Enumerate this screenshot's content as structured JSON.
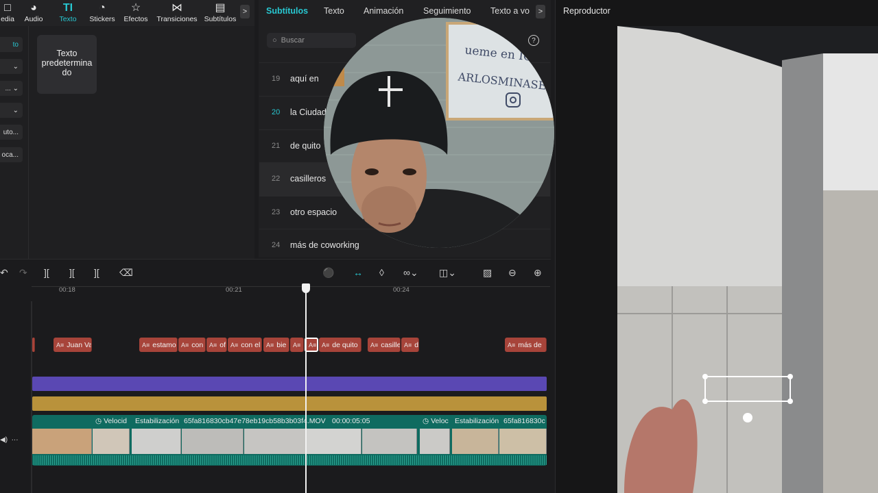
{
  "toolbar": {
    "items": [
      {
        "label": "edia",
        "icon": "media-icon"
      },
      {
        "label": "Audio",
        "icon": "audio-icon"
      },
      {
        "label": "Texto",
        "icon": "text-icon",
        "active": true
      },
      {
        "label": "Stickers",
        "icon": "sticker-icon"
      },
      {
        "label": "Efectos",
        "icon": "effects-icon"
      },
      {
        "label": "Transiciones",
        "icon": "transition-icon"
      },
      {
        "label": "Subtítulos",
        "icon": "subtitles-icon"
      }
    ],
    "more": ">"
  },
  "left_panel": {
    "items": [
      "to",
      "",
      "...",
      "",
      "uto...",
      "oca..."
    ],
    "preset_label": "Texto predetermina do"
  },
  "subtitles": {
    "tabs": [
      "Subtítulos",
      "Texto",
      "Animación",
      "Seguimiento",
      "Texto a vo"
    ],
    "more": ">",
    "search_placeholder": "Buscar",
    "help": "?",
    "rows": [
      {
        "num": "19",
        "text": "aquí en"
      },
      {
        "num": "20",
        "text": "la Ciudad"
      },
      {
        "num": "21",
        "text": "de quito"
      },
      {
        "num": "22",
        "text": "casilleros"
      },
      {
        "num": "23",
        "text": "otro espacio"
      },
      {
        "num": "24",
        "text": "más de coworking"
      }
    ]
  },
  "player": {
    "title": "Reproductor"
  },
  "timeline": {
    "ruler": [
      "00:18",
      "00:21",
      "00:24"
    ],
    "captions": [
      "Juan Va",
      "estamo",
      "con",
      "of",
      "con el",
      "bie",
      "",
      "",
      "de quito",
      "casille",
      "d",
      "más de"
    ],
    "video_labels": {
      "speed": "Velocid",
      "stab": "Estabilización",
      "file": "65fa816830cb47e78eb19cb58b3b03f4.MOV",
      "duration": "00:00:05:05",
      "speed2": "Veloc",
      "stab2": "Estabilización",
      "file2": "65fa816830c"
    },
    "colors": {
      "caption": "#a7443a",
      "purple": "#5a48b3",
      "gold": "#b9923b",
      "video": "#0f6b60",
      "accent": "#28c8d2"
    }
  }
}
